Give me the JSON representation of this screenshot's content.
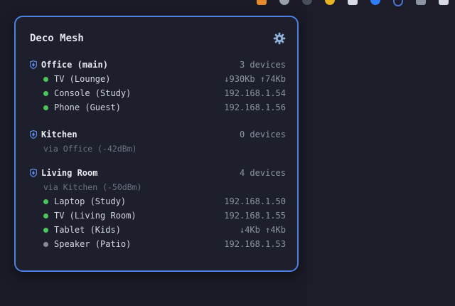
{
  "colors": {
    "accent_border": "#4f80e1",
    "online": "#4cc45a",
    "offline": "#8b8b93",
    "shield": "#5b8be6"
  },
  "tray_icons": [
    "wifi-signal-icon",
    "camera-icon",
    "headphones-icon",
    "notification-bell-icon",
    "cloud-icon",
    "blue-circle-icon",
    "shield-icon",
    "network-icon",
    "user-icon"
  ],
  "popup": {
    "title": "Deco Mesh",
    "settings_icon": "gear-icon",
    "nodes": [
      {
        "name": "Office (main)",
        "count": "3 devices",
        "via": null,
        "devices": [
          {
            "name": "TV (Lounge)",
            "info": "↓930Kb ↑74Kb",
            "status": "online"
          },
          {
            "name": "Console (Study)",
            "info": "192.168.1.54",
            "status": "online"
          },
          {
            "name": "Phone (Guest)",
            "info": "192.168.1.56",
            "status": "online"
          }
        ]
      },
      {
        "name": "Kitchen",
        "count": "0 devices",
        "via": "via Office (-42dBm)",
        "devices": []
      },
      {
        "name": "Living Room",
        "count": "4 devices",
        "via": "via Kitchen (-50dBm)",
        "devices": [
          {
            "name": "Laptop (Study)",
            "info": "192.168.1.50",
            "status": "online"
          },
          {
            "name": "TV (Living Room)",
            "info": "192.168.1.55",
            "status": "online"
          },
          {
            "name": "Tablet (Kids)",
            "info": "↓4Kb ↑4Kb",
            "status": "online"
          },
          {
            "name": "Speaker (Patio)",
            "info": "192.168.1.53",
            "status": "offline"
          }
        ]
      }
    ]
  }
}
